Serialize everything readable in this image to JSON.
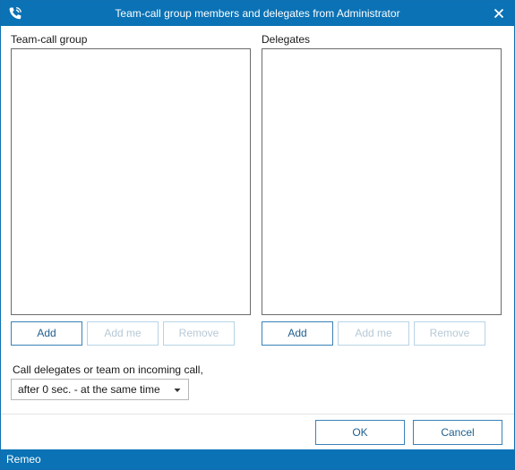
{
  "window": {
    "title": "Team-call group members and delegates from Administrator",
    "app_icon": "phone-icon",
    "close_icon": "close-icon"
  },
  "team_group": {
    "label": "Team-call group",
    "items": [],
    "buttons": {
      "add": "Add",
      "add_me": "Add me",
      "remove": "Remove"
    }
  },
  "delegates": {
    "label": "Delegates",
    "items": [],
    "buttons": {
      "add": "Add",
      "add_me": "Add me",
      "remove": "Remove"
    }
  },
  "call_option": {
    "label": "Call delegates or team on incoming call,",
    "selected": "after 0 sec.  - at the same time"
  },
  "dialog_buttons": {
    "ok": "OK",
    "cancel": "Cancel"
  },
  "status_bar": {
    "text": "Remeo"
  },
  "colors": {
    "accent": "#0a72b5",
    "button_border": "#3a82b8",
    "disabled_text": "#b7c9d6"
  }
}
